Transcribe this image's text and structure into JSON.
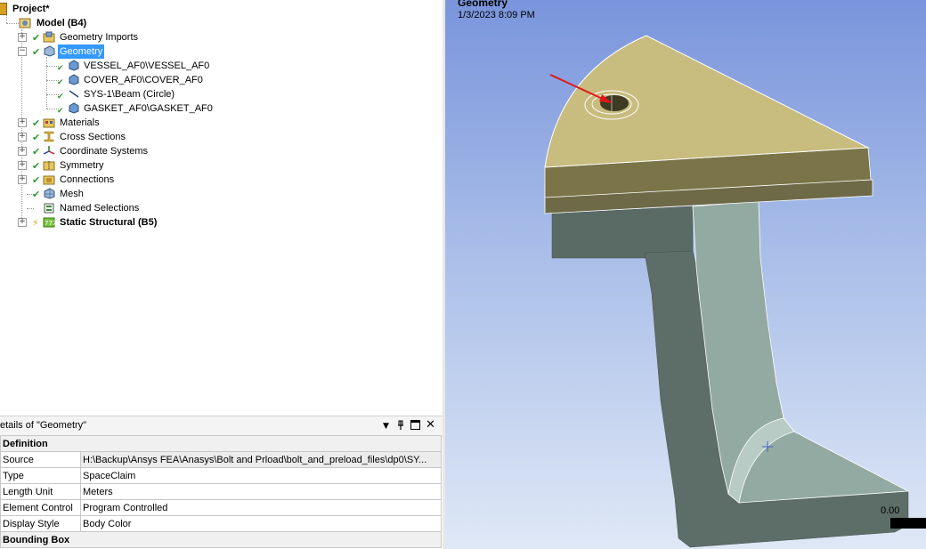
{
  "tree": {
    "project": "Project*",
    "model": "Model (B4)",
    "geometry_imports": "Geometry Imports",
    "geometry": "Geometry",
    "bodies": [
      "VESSEL_AF0\\VESSEL_AF0",
      "COVER_AF0\\COVER_AF0",
      "SYS-1\\Beam (Circle)",
      "GASKET_AF0\\GASKET_AF0"
    ],
    "materials": "Materials",
    "cross_sections": "Cross Sections",
    "coordinate_systems": "Coordinate Systems",
    "symmetry": "Symmetry",
    "connections": "Connections",
    "mesh": "Mesh",
    "named_selections": "Named Selections",
    "static_structural": "Static Structural (B5)"
  },
  "details": {
    "title": "etails of \"Geometry\"",
    "buttons": {
      "dropdown": "▼",
      "pin": "📌",
      "maximize": "☐",
      "close": "✕"
    },
    "group_definition": "Definition",
    "rows": [
      {
        "key": "Source",
        "value": "H:\\Backup\\Ansys FEA\\Anasys\\Bolt and Prload\\bolt_and_preload_files\\dp0\\SY..."
      },
      {
        "key": "Type",
        "value": "SpaceClaim"
      },
      {
        "key": "Length Unit",
        "value": "Meters"
      },
      {
        "key": "Element Control",
        "value": "Program Controlled"
      },
      {
        "key": "Display Style",
        "value": "Body Color"
      }
    ],
    "group_bounding_box": "Bounding Box"
  },
  "viewport": {
    "title": "Geometry",
    "date": "1/3/2023 8:09 PM",
    "scale_value": "0.00"
  },
  "colors": {
    "selection": "#3399ff",
    "cover_top": "#c8bc7e",
    "vessel": "#5b6b66",
    "arrow": "#e01818"
  }
}
